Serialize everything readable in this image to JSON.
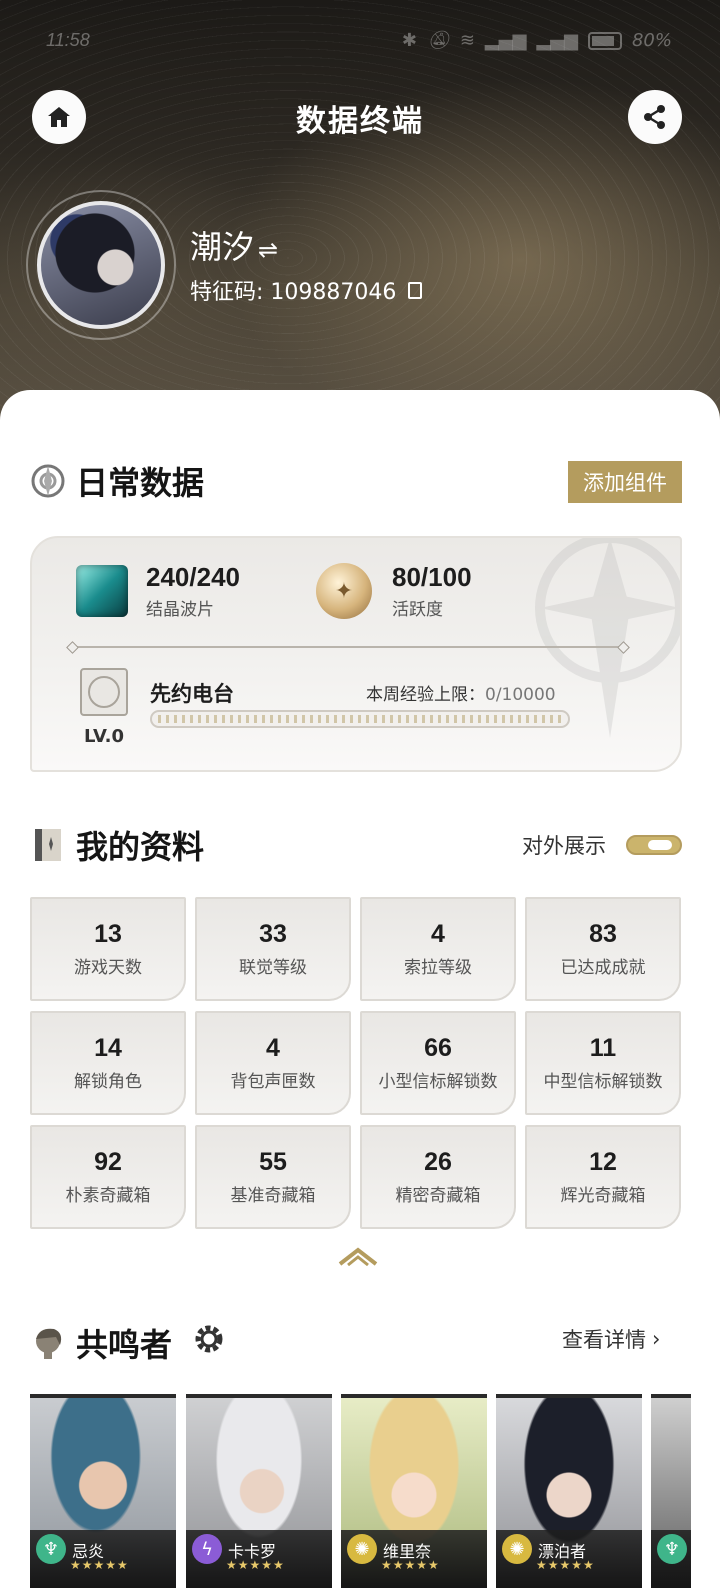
{
  "status_bar": {
    "time": "11:58",
    "battery": "80%"
  },
  "header": {
    "title": "数据终端",
    "home_icon": "home-icon",
    "share_icon": "share-icon"
  },
  "profile": {
    "name": "潮汐",
    "switch_icon": "⇌",
    "uid_label": "特征码: 109887046"
  },
  "daily": {
    "title": "日常数据",
    "add_widget_label": "添加组件",
    "waveplates": {
      "value": "240/240",
      "label": "结晶波片"
    },
    "activity": {
      "value": "80/100",
      "label": "活跃度"
    },
    "radio": {
      "name": "先约电台",
      "level": "LV.0",
      "weekly_cap_label": "本周经验上限：",
      "weekly_cap_value": "0/10000",
      "progress": 0
    }
  },
  "my_profile": {
    "title": "我的资料",
    "public_display_label": "对外展示",
    "public_display_on": true,
    "stats": [
      {
        "num": "13",
        "label": "游戏天数"
      },
      {
        "num": "33",
        "label": "联觉等级"
      },
      {
        "num": "4",
        "label": "索拉等级"
      },
      {
        "num": "83",
        "label": "已达成成就"
      },
      {
        "num": "14",
        "label": "解锁角色"
      },
      {
        "num": "4",
        "label": "背包声匣数"
      },
      {
        "num": "66",
        "label": "小型信标解锁数"
      },
      {
        "num": "11",
        "label": "中型信标解锁数"
      },
      {
        "num": "92",
        "label": "朴素奇藏箱"
      },
      {
        "num": "55",
        "label": "基准奇藏箱"
      },
      {
        "num": "26",
        "label": "精密奇藏箱"
      },
      {
        "num": "12",
        "label": "辉光奇藏箱"
      }
    ]
  },
  "resonators": {
    "title": "共鸣者",
    "see_details_label": "查看详情",
    "list": [
      {
        "name": "忌炎",
        "element_color": "#3fb58a",
        "stars": "★★★★★"
      },
      {
        "name": "卡卡罗",
        "element_color": "#8b5cd6",
        "stars": "★★★★★"
      },
      {
        "name": "维里奈",
        "element_color": "#d8b940",
        "stars": "★★★★★"
      },
      {
        "name": "漂泊者",
        "element_color": "#d8b940",
        "stars": "★★★★★"
      },
      {
        "name": "",
        "element_color": "#3fb58a",
        "stars": ""
      }
    ]
  },
  "colors": {
    "accent_gold": "#b49c5e",
    "header_dark": "#2c2822"
  }
}
